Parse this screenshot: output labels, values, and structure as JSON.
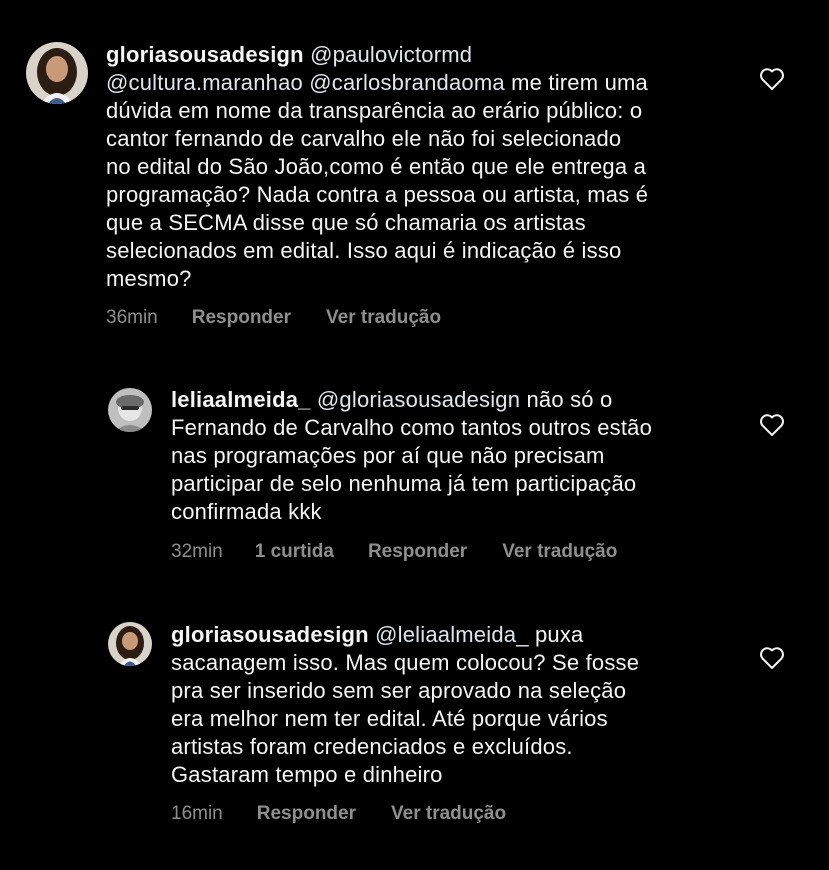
{
  "comments": [
    {
      "username": "gloriasousadesign",
      "mentions_line1": "@paulovictormd",
      "mentions_line2a": "@cultura.maranhao",
      "mentions_line2b": "@carlosbrandaoma",
      "text_after_mentions": "me tirem uma",
      "body": "dúvida em nome da transparência ao erário público: o\ncantor fernando de carvalho ele não foi selecionado\nno edital do São João,como é então que ele entrega a\nprogramação? Nada contra a pessoa ou artista, mas é\nque a SECMA disse que só chamaria os artistas\nselecionados em edital. Isso aqui é indicação é isso\nmesmo?",
      "time": "36min",
      "reply_label": "Responder",
      "translate_label": "Ver tradução"
    },
    {
      "username": "leliaalmeida_",
      "mention": "@gloriasousadesign",
      "text_after_mention": "não só o",
      "body": "Fernando de Carvalho como tantos outros estão\nnas programações por aí que não precisam\nparticipar de selo nenhuma já tem participação\nconfirmada kkk",
      "time": "32min",
      "likes": "1 curtida",
      "reply_label": "Responder",
      "translate_label": "Ver tradução"
    },
    {
      "username": "gloriasousadesign",
      "mention": "@leliaalmeida_",
      "text_after_mention": "puxa",
      "body": "sacanagem isso. Mas quem colocou? Se fosse\npra ser inserido sem ser aprovado na seleção\nera melhor nem ter edital. Até porque vários\nartistas foram credenciados e excluídos.\nGastaram tempo e dinheiro",
      "time": "16min",
      "reply_label": "Responder",
      "translate_label": "Ver tradução"
    }
  ],
  "icons": {
    "like": "heart-outline-icon"
  },
  "colors": {
    "background": "#000000",
    "text": "#f5f5f5",
    "meta": "#8e8e8e"
  }
}
